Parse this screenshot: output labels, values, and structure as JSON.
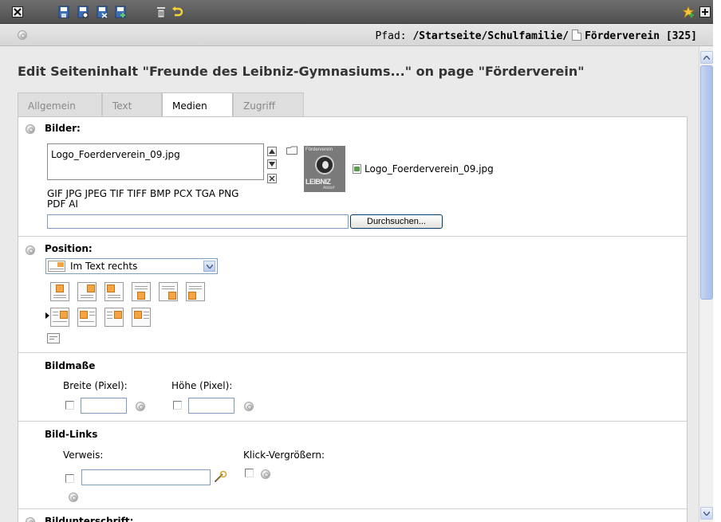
{
  "toolbar": {
    "icons": [
      "close-icon",
      "save-icon",
      "save-view-icon",
      "save-close-icon",
      "save-new-icon",
      "delete-icon",
      "undo-icon",
      "shortcut-icon",
      "open-new-window-icon"
    ]
  },
  "path": {
    "label": "Pfad:",
    "path": "/Startseite/Schulfamilie/",
    "page": "Förderverein [325]"
  },
  "title": "Edit Seiteninhalt \"Freunde des Leibniz-Gymnasiums...\" on page \"Förderverein\"",
  "tabs": [
    {
      "label": "Allgemein",
      "active": false
    },
    {
      "label": "Text",
      "active": false
    },
    {
      "label": "Medien",
      "active": true
    },
    {
      "label": "Zugriff",
      "active": false
    }
  ],
  "bilder": {
    "title": "Bilder:",
    "file": "Logo_Foerderverein_09.jpg",
    "thumb_label": "Logo_Foerderverein_09.jpg",
    "logo_top": "Förderverein",
    "logo_bottom": "LEIBNIZ",
    "logo_sub": "Altdorf",
    "types_line1": "GIF JPG JPEG TIF TIFF BMP PCX TGA PNG",
    "types_line2": "PDF AI",
    "browse_label": "Durchsuchen..."
  },
  "position": {
    "title": "Position:",
    "selected": "Im Text rechts"
  },
  "bildmasse": {
    "title": "Bildmaße",
    "width_label": "Breite (Pixel):",
    "height_label": "Höhe (Pixel):"
  },
  "bildlinks": {
    "title": "Bild-Links",
    "link_label": "Verweis:",
    "zoom_label": "Klick-Vergrößern:"
  },
  "caption": {
    "title": "Bildunterschrift:"
  },
  "colors": {
    "accent_orange": "#f4a541",
    "scroll_blue": "#b6c8ee",
    "toolbar_dark": "#5a5a5a"
  }
}
